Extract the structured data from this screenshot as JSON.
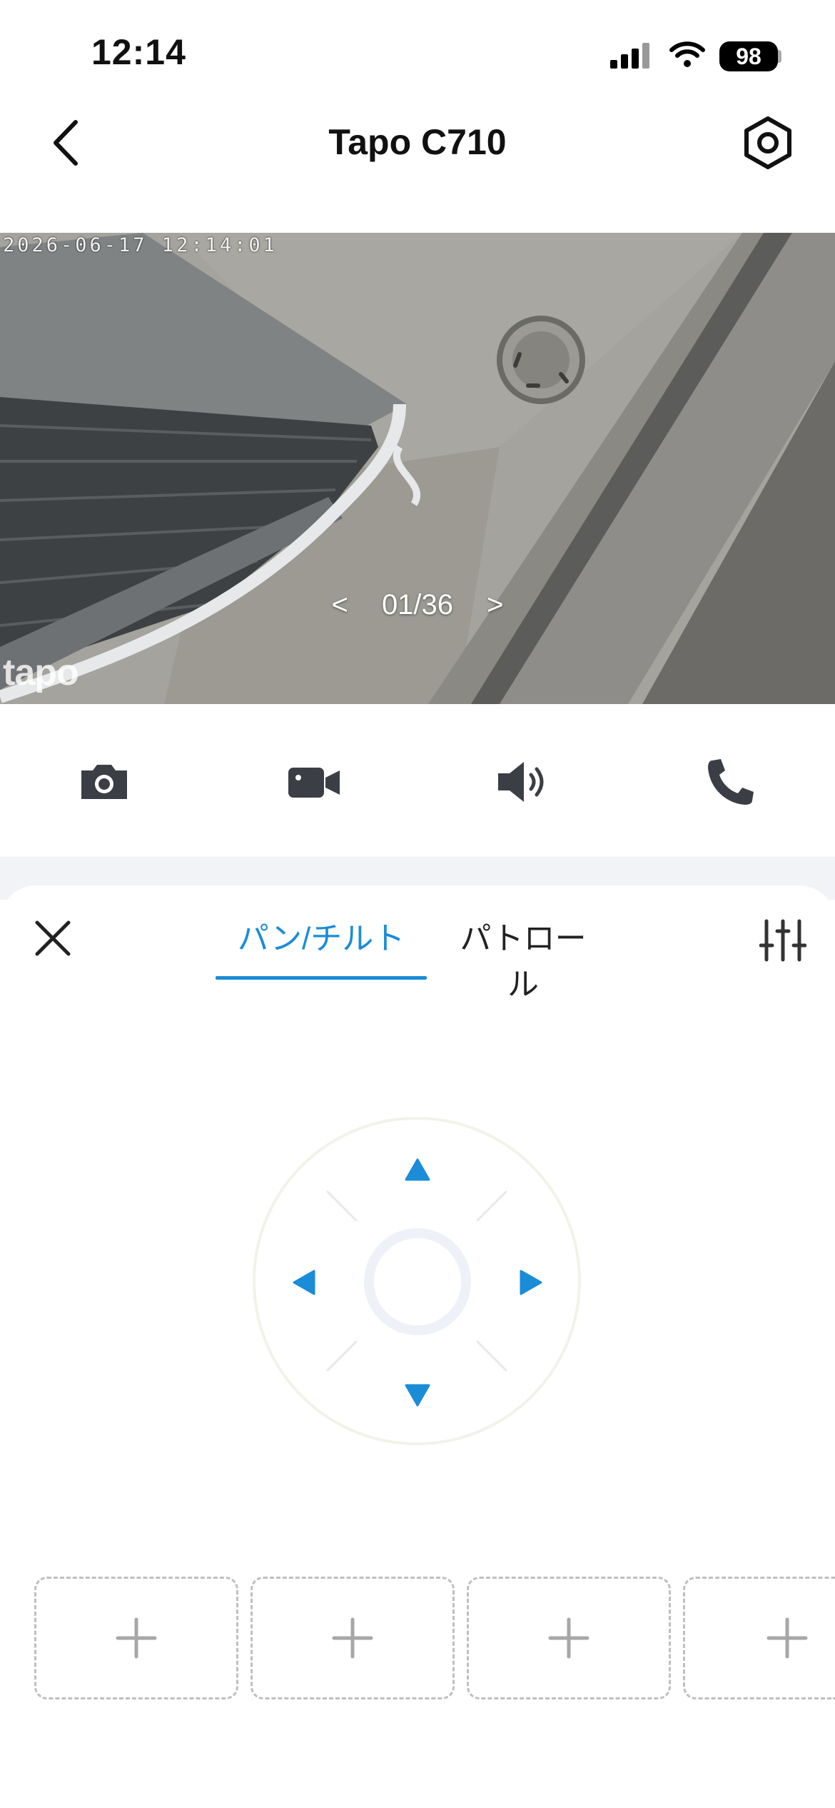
{
  "status_bar": {
    "time": "12:14",
    "battery": "98"
  },
  "header": {
    "title": "Tapo C710"
  },
  "video": {
    "timestamp": "2026-06-17 12:14:01",
    "watermark": "tapo",
    "pager": {
      "prev": "<",
      "current": "01/36",
      "next": ">"
    }
  },
  "actions": [
    {
      "icon": "camera-icon"
    },
    {
      "icon": "video-record-icon"
    },
    {
      "icon": "speaker-icon"
    },
    {
      "icon": "phone-icon"
    }
  ],
  "tabs": {
    "active": "パン/チルト",
    "inactive": "パトロール"
  },
  "preset_slots": [
    "+",
    "+",
    "+",
    "+"
  ],
  "colors": {
    "accent": "#1a8cd8"
  }
}
